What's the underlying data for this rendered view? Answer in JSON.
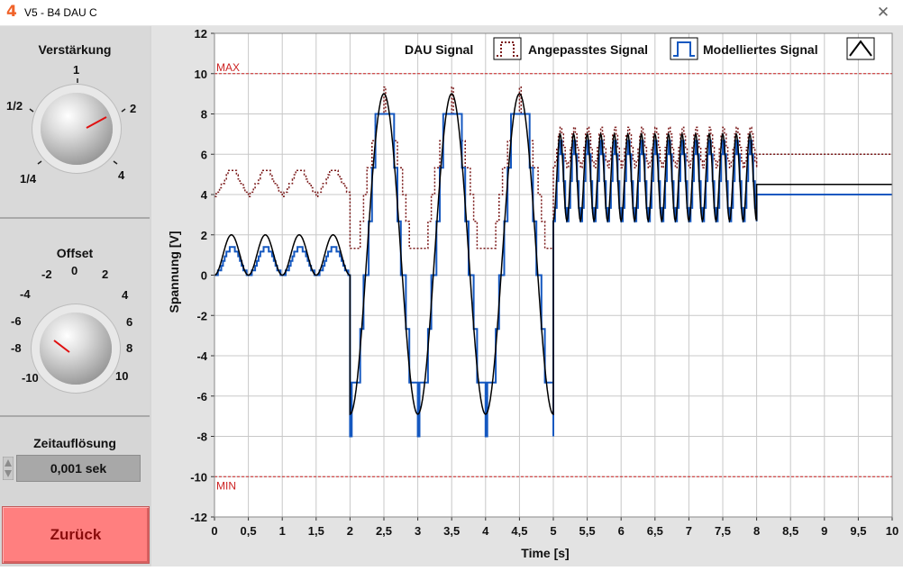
{
  "window": {
    "title": "V5 - B4 DAU C",
    "icon": "labview-4-icon",
    "close_glyph": "✕"
  },
  "controls": {
    "gain": {
      "title": "Verstärkung",
      "ticks": [
        "1/4",
        "1/2",
        "1",
        "2",
        "4"
      ],
      "value": "2"
    },
    "offset": {
      "title": "Offset",
      "ticks": [
        "-10",
        "-8",
        "-6",
        "-4",
        "-2",
        "0",
        "2",
        "4",
        "6",
        "8",
        "10"
      ],
      "value": "-6"
    },
    "time_resolution": {
      "title": "Zeitauflösung",
      "value": "0,001 sek"
    },
    "back_button": "Zurück"
  },
  "colors": {
    "dau": "#7b1a1a",
    "adapted": "#1558c0",
    "model": "#000000",
    "limit": "#cc2222",
    "button": "#ff7f7f"
  },
  "chart_data": {
    "type": "line",
    "xlabel": "Time [s]",
    "ylabel": "Spannung [V]",
    "xlim": [
      0,
      10
    ],
    "ylim": [
      -12,
      12
    ],
    "x_ticks": [
      "0",
      "0,5",
      "1",
      "1,5",
      "2",
      "2,5",
      "3",
      "3,5",
      "4",
      "4,5",
      "5",
      "5,5",
      "6",
      "6,5",
      "7",
      "7,5",
      "8",
      "8,5",
      "9",
      "9,5",
      "10"
    ],
    "y_ticks": [
      "12",
      "10",
      "8",
      "6",
      "4",
      "2",
      "0",
      "-2",
      "-4",
      "-6",
      "-8",
      "-10",
      "-12"
    ],
    "grid": true,
    "legend_position": "top-right",
    "limits": [
      {
        "label": "MAX",
        "value": 10
      },
      {
        "label": "MIN",
        "value": -10
      }
    ],
    "segments": [
      {
        "x": [
          0,
          2
        ],
        "frequency_hz": 2,
        "model_min": 0,
        "model_max": 2,
        "adapted_min": 0,
        "adapted_max": 1.4,
        "dau_min": 4,
        "dau_max": 5.3
      },
      {
        "x": [
          2,
          5
        ],
        "frequency_hz": 1,
        "model_min": -6.9,
        "model_max": 9,
        "adapted_min": -6.7,
        "adapted_max": 9.3,
        "dau_min": 0.7,
        "dau_max": 8.7
      },
      {
        "x": [
          5,
          8
        ],
        "frequency_hz": 5,
        "model_min": 2.7,
        "model_max": 7,
        "adapted_min": 2.7,
        "adapted_max": 6.7,
        "dau_min": 5.3,
        "dau_max": 7.3
      },
      {
        "x": [
          8,
          10
        ],
        "frequency_hz": 0,
        "model_min": 4.5,
        "model_max": 4.5,
        "adapted_min": 4,
        "adapted_max": 4,
        "dau_min": 6,
        "dau_max": 6
      }
    ],
    "series": [
      {
        "name": "DAU Signal",
        "style": "dotted-step"
      },
      {
        "name": "Angepasstes Signal",
        "style": "step"
      },
      {
        "name": "Modelliertes Signal",
        "style": "line"
      }
    ]
  }
}
